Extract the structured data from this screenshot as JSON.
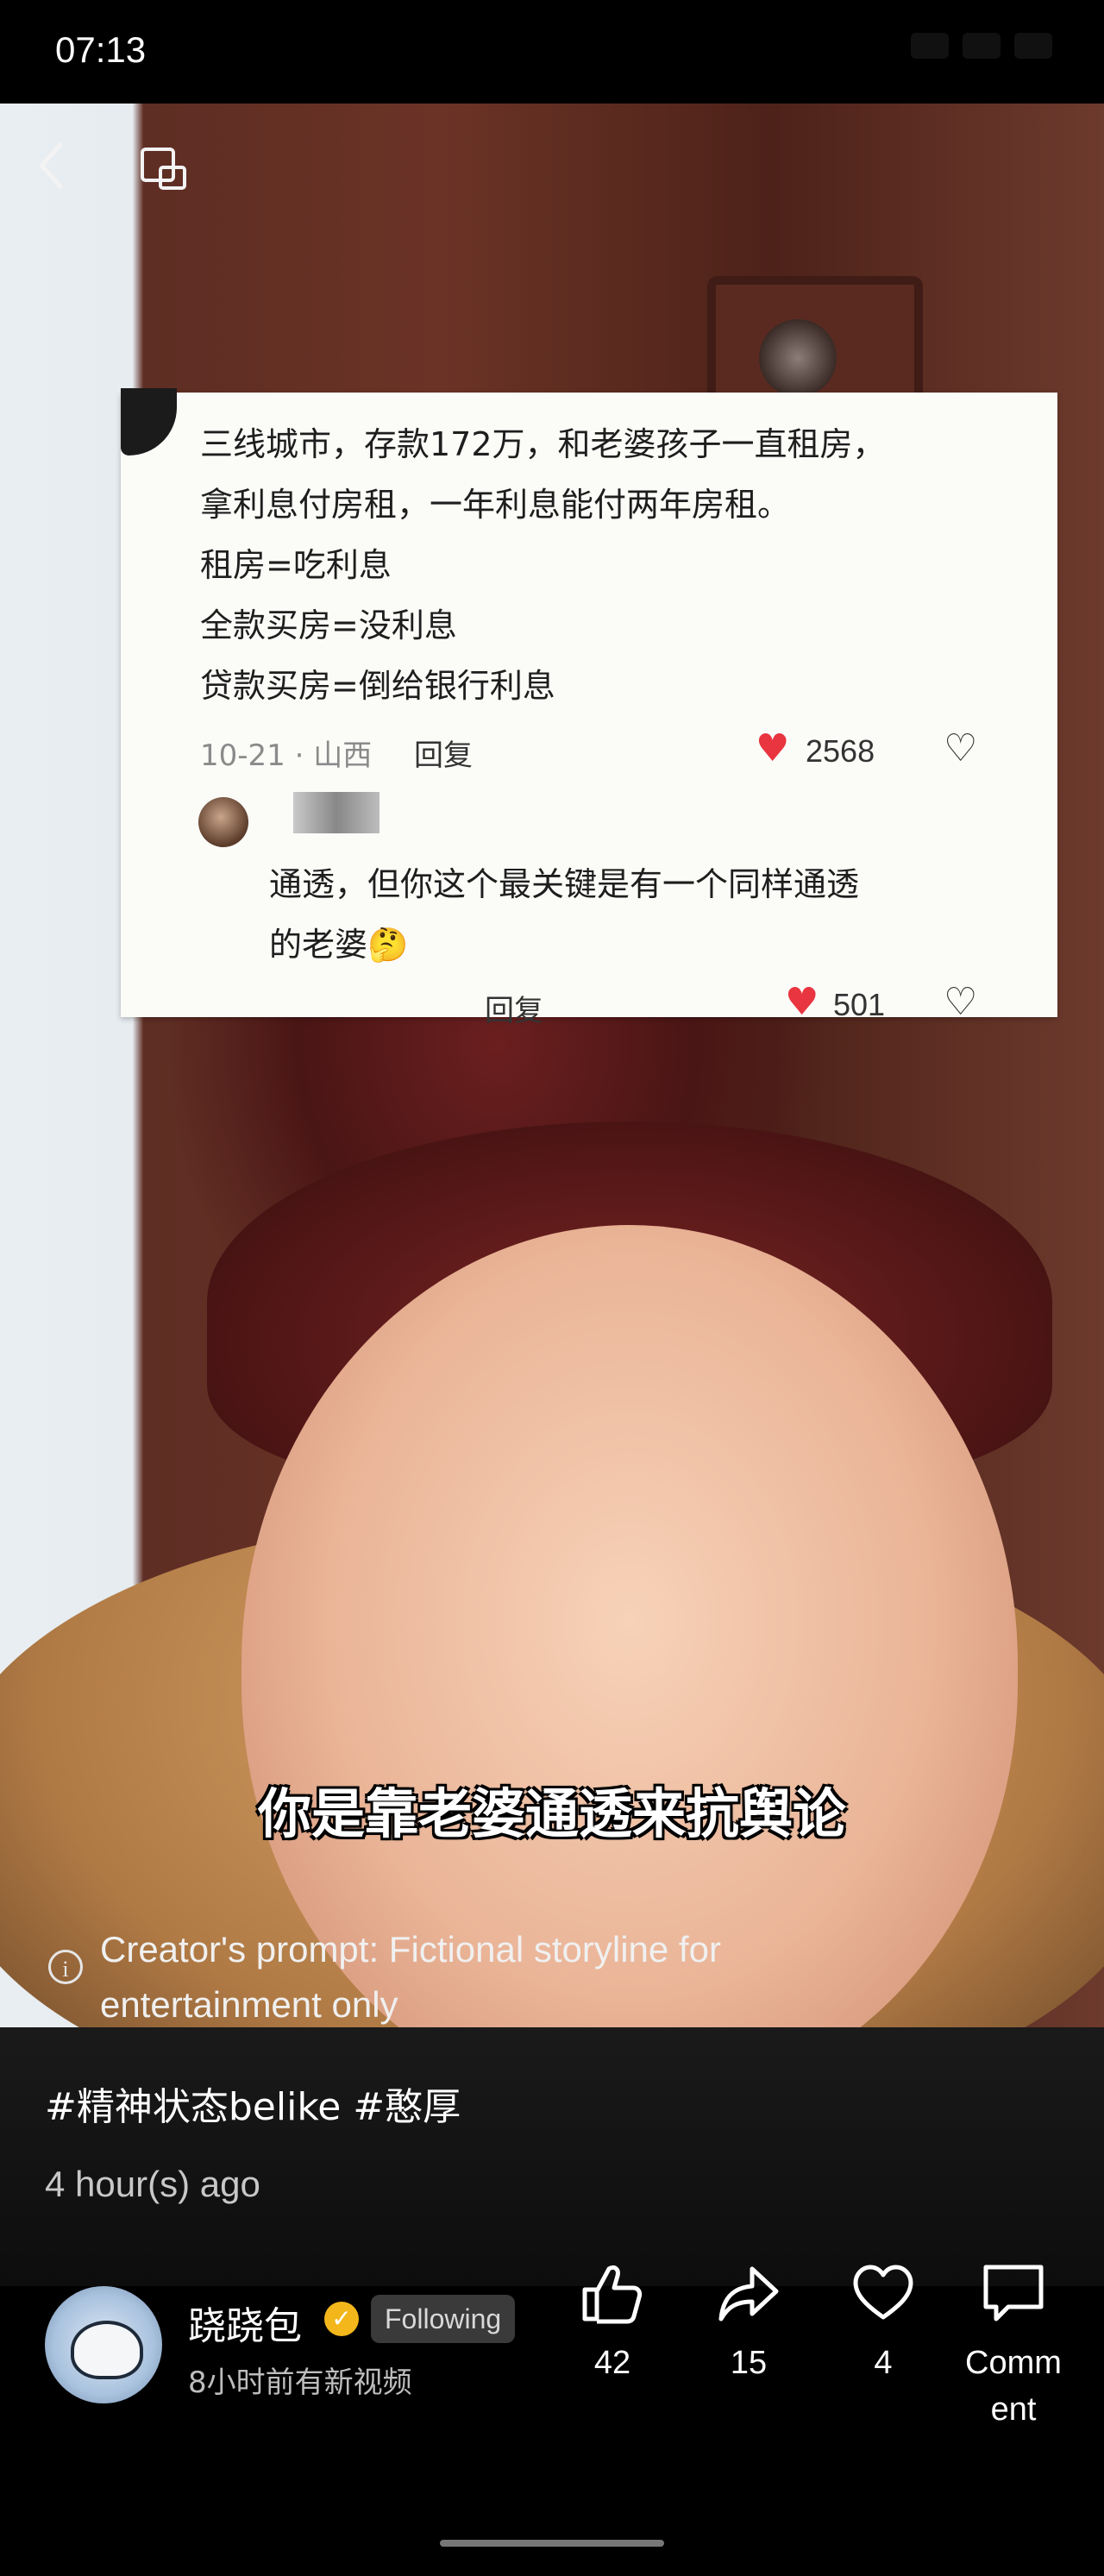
{
  "status_bar": {
    "time": "07:13"
  },
  "video": {
    "screenshot_comment": {
      "lines": [
        "三线城市，存款172万，和老婆孩子一直租房，",
        "拿利息付房租，一年利息能付两年房租。",
        "租房=吃利息",
        "全款买房=没利息",
        "贷款买房=倒给银行利息"
      ],
      "date_location": "10-21 · 山西",
      "reply_label": "回复",
      "likes": "2568"
    },
    "screenshot_reply": {
      "lines": [
        "通透，但你这个最关键是有一个同样通透",
        "的老婆🤔"
      ],
      "reply_label": "回复",
      "likes": "501"
    },
    "subtitle": "你是靠老婆通透来抗舆论"
  },
  "post": {
    "creator_prompt": "Creator's prompt: Fictional storyline for entertainment only",
    "hashtags": "#精神状态belike #憨厚",
    "time_ago": "4 hour(s) ago"
  },
  "creator": {
    "name": "跷跷包",
    "follow_label": "Following",
    "subtitle": "8小时前有新视频"
  },
  "actions": {
    "like_count": "42",
    "share_count": "15",
    "favorite_count": "4",
    "comment_label": "Comm\nent"
  },
  "colors": {
    "heart": "#e8353f",
    "verified": "#f3b71b",
    "follow_bg": "#3a3a3a"
  }
}
